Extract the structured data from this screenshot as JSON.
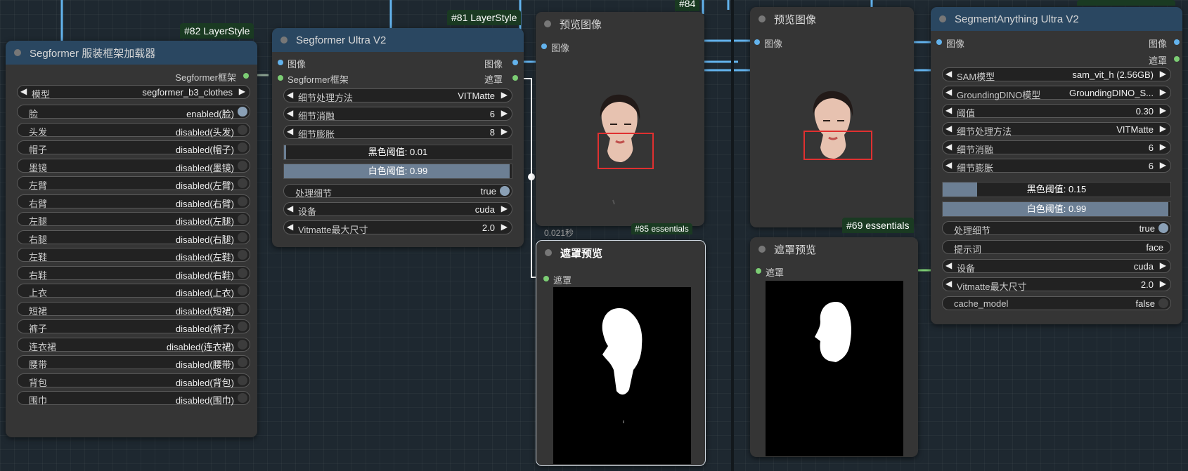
{
  "badges": {
    "b82": "#82 LayerStyle",
    "b81": "#81 LayerStyle",
    "b84": "#84",
    "b69": "#69 essentials",
    "b85": "#85 essentials",
    "timing": "0.021秒"
  },
  "node_loader": {
    "title": "Segformer 服装框架加载器",
    "output_label": "Segformer框架",
    "combo": {
      "label": "模型",
      "value": "segformer_b3_clothes"
    },
    "toggles": [
      {
        "label": "脸",
        "value": "enabled(脸)",
        "on": true
      },
      {
        "label": "头发",
        "value": "disabled(头发)",
        "on": false
      },
      {
        "label": "帽子",
        "value": "disabled(帽子)",
        "on": false
      },
      {
        "label": "墨镜",
        "value": "disabled(墨镜)",
        "on": false
      },
      {
        "label": "左臂",
        "value": "disabled(左臂)",
        "on": false
      },
      {
        "label": "右臂",
        "value": "disabled(右臂)",
        "on": false
      },
      {
        "label": "左腿",
        "value": "disabled(左腿)",
        "on": false
      },
      {
        "label": "右腿",
        "value": "disabled(右腿)",
        "on": false
      },
      {
        "label": "左鞋",
        "value": "disabled(左鞋)",
        "on": false
      },
      {
        "label": "右鞋",
        "value": "disabled(右鞋)",
        "on": false
      },
      {
        "label": "上衣",
        "value": "disabled(上衣)",
        "on": false
      },
      {
        "label": "短裙",
        "value": "disabled(短裙)",
        "on": false
      },
      {
        "label": "裤子",
        "value": "disabled(裤子)",
        "on": false
      },
      {
        "label": "连衣裙",
        "value": "disabled(连衣裙)",
        "on": false
      },
      {
        "label": "腰带",
        "value": "disabled(腰带)",
        "on": false
      },
      {
        "label": "背包",
        "value": "disabled(背包)",
        "on": false
      },
      {
        "label": "围巾",
        "value": "disabled(围巾)",
        "on": false
      }
    ]
  },
  "node_segformer": {
    "title": "Segformer Ultra V2",
    "in1": "图像",
    "in2": "Segformer框架",
    "out1": "图像",
    "out2": "遮罩",
    "detail_method": {
      "label": "细节处理方法",
      "value": "VITMatte"
    },
    "detail_erode": {
      "label": "细节消融",
      "value": "6"
    },
    "detail_dilate": {
      "label": "细节膨胀",
      "value": "8"
    },
    "black": {
      "text": "黑色阈值: 0.01",
      "fraction": 0.01
    },
    "white": {
      "text": "白色阈值: 0.99",
      "fraction": 0.99
    },
    "process_detail": {
      "label": "处理细节",
      "value": "true"
    },
    "device": {
      "label": "设备",
      "value": "cuda"
    },
    "vitmatte": {
      "label": "Vitmatte最大尺寸",
      "value": "2.0"
    }
  },
  "preview1": {
    "title": "预览图像",
    "input": "图像"
  },
  "mask1": {
    "title": "遮罩预览",
    "input": "遮罩"
  },
  "preview2": {
    "title": "预览图像",
    "input": "图像"
  },
  "mask2": {
    "title": "遮罩预览",
    "input": "遮罩"
  },
  "node_sam": {
    "title": "SegmentAnything Ultra V2",
    "in1": "图像",
    "out1": "图像",
    "out2": "遮罩",
    "sam_model": {
      "label": "SAM模型",
      "value": "sam_vit_h (2.56GB)"
    },
    "dino_model": {
      "label": "GroundingDINO模型",
      "value": "GroundingDINO_S..."
    },
    "threshold": {
      "label": "阈值",
      "value": "0.30"
    },
    "detail_method": {
      "label": "细节处理方法",
      "value": "VITMatte"
    },
    "detail_erode": {
      "label": "细节消融",
      "value": "6"
    },
    "detail_dilate": {
      "label": "细节膨胀",
      "value": "6"
    },
    "black": {
      "text": "黑色阈值: 0.15",
      "fraction": 0.15
    },
    "white": {
      "text": "白色阈值: 0.99",
      "fraction": 0.99
    },
    "process_detail": {
      "label": "处理细节",
      "value": "true"
    },
    "prompt": {
      "label": "提示词",
      "value": "face"
    },
    "device": {
      "label": "设备",
      "value": "cuda"
    },
    "vitmatte": {
      "label": "Vitmatte最大尺寸",
      "value": "2.0"
    },
    "cache_model": {
      "label": "cache_model",
      "value": "false"
    }
  },
  "colors": {
    "image_link": "#63b3ed",
    "mask_link": "#7ccd74",
    "red_box": "#e03030"
  }
}
